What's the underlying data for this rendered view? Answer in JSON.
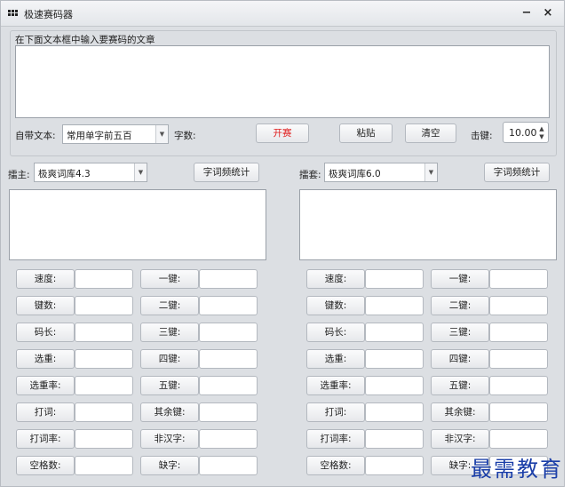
{
  "window": {
    "title": "极速赛码器",
    "minimize_label": "−",
    "close_label": "×"
  },
  "top": {
    "article_prompt": "在下面文本框中输入要赛码的文章",
    "builtin_text_label": "自带文本:",
    "builtin_text_value": "常用单字前五百",
    "char_count_label": "字数:",
    "start_button": "开赛",
    "paste_button": "粘贴",
    "clear_button": "清空",
    "keystroke_label": "击键:",
    "keystroke_value": "10.00"
  },
  "left": {
    "label": "擂主:",
    "dict_value": "极爽词库4.3",
    "freq_button": "字词频统计"
  },
  "right": {
    "label": "擂套:",
    "dict_value": "极爽词库6.0",
    "freq_button": "字词频统计"
  },
  "stats": {
    "col1": [
      "速度:",
      "键数:",
      "码长:",
      "选重:",
      "选重率:",
      "打词:",
      "打词率:",
      "空格数:"
    ],
    "col2": [
      "一键:",
      "二键:",
      "三键:",
      "四键:",
      "五键:",
      "其余键:",
      "非汉字:",
      "缺字:"
    ]
  },
  "watermark": "最需教育"
}
